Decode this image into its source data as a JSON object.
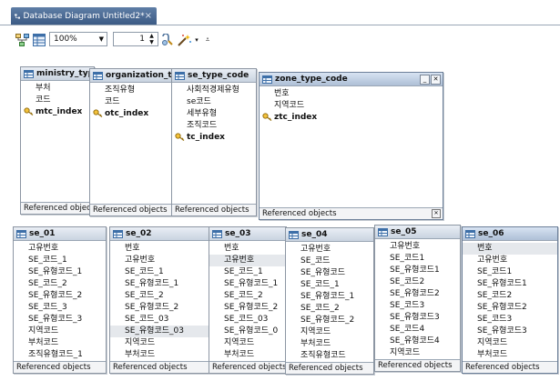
{
  "tab": {
    "title": "Database Diagram Untitled2*",
    "close": "×"
  },
  "toolbar": {
    "zoom": "100%",
    "page": "1",
    "icons": [
      "layout-icon",
      "table-icon",
      "dropdown-arrow-icon",
      "link-icon",
      "magic-icon",
      "overflow-icon"
    ]
  },
  "footer_label": "Referenced objects",
  "tables": [
    {
      "id": "ministry",
      "name": "ministry_typ",
      "rows": [
        {
          "text": "부처"
        },
        {
          "text": "코드"
        },
        {
          "text": "mtc_index",
          "key": true
        }
      ]
    },
    {
      "id": "organization",
      "name": "organization_ty",
      "rows": [
        {
          "text": "조직유형"
        },
        {
          "text": "코드"
        },
        {
          "text": "otc_index",
          "key": true
        }
      ]
    },
    {
      "id": "se_type_code",
      "name": "se_type_code",
      "rows": [
        {
          "text": "사회적경제유형"
        },
        {
          "text": "se코드"
        },
        {
          "text": "세부유형"
        },
        {
          "text": "조직코드"
        },
        {
          "text": "tc_index",
          "key": true
        }
      ]
    },
    {
      "id": "zone_type_code",
      "name": "zone_type_code",
      "rows": [
        {
          "text": "번호"
        },
        {
          "text": "지역코드"
        },
        {
          "text": "ztc_index",
          "key": true
        }
      ]
    },
    {
      "id": "se_01",
      "name": "se_01",
      "rows": [
        {
          "text": "고유번호"
        },
        {
          "text": "SE_코드_1"
        },
        {
          "text": "SE_유형코드_1"
        },
        {
          "text": "SE_코드_2"
        },
        {
          "text": "SE_유형코드_2"
        },
        {
          "text": "SE_코드_3"
        },
        {
          "text": "SE_유형코드_3"
        },
        {
          "text": "지역코드"
        },
        {
          "text": "부처코드"
        },
        {
          "text": "조직유형코드_1"
        }
      ]
    },
    {
      "id": "se_02",
      "name": "se_02",
      "rows": [
        {
          "text": "번호"
        },
        {
          "text": "고유번호"
        },
        {
          "text": "SE_코드_1"
        },
        {
          "text": "SE_유형코드_1"
        },
        {
          "text": "SE_코드_2"
        },
        {
          "text": "SE_유형코드_2"
        },
        {
          "text": "SE_코드_03"
        },
        {
          "text": "SE_유형코드_03",
          "hl": true
        },
        {
          "text": "지역코드"
        },
        {
          "text": "부처코드"
        }
      ]
    },
    {
      "id": "se_03",
      "name": "se_03",
      "rows": [
        {
          "text": "번호"
        },
        {
          "text": "고유번호",
          "hl": true
        },
        {
          "text": "SE_코드_1"
        },
        {
          "text": "SE_유형코드_1"
        },
        {
          "text": "SE_코드_2"
        },
        {
          "text": "SE_유형코드_2"
        },
        {
          "text": "SE_코드_03"
        },
        {
          "text": "SE_유형코드_0"
        },
        {
          "text": "지역코드"
        },
        {
          "text": "부처코드"
        }
      ]
    },
    {
      "id": "se_04",
      "name": "se_04",
      "rows": [
        {
          "text": "고유번호"
        },
        {
          "text": "SE_코드"
        },
        {
          "text": "SE_유형코드"
        },
        {
          "text": "SE_코드_1"
        },
        {
          "text": "SE_유형코드_1"
        },
        {
          "text": "SE_코드_2"
        },
        {
          "text": "SE_유형코드_2"
        },
        {
          "text": "지역코드"
        },
        {
          "text": "부처코드"
        },
        {
          "text": "조직유형코드"
        }
      ]
    },
    {
      "id": "se_05",
      "name": "se_05",
      "rows": [
        {
          "text": "고유번호"
        },
        {
          "text": "SE_코드1"
        },
        {
          "text": "SE_유형코드1"
        },
        {
          "text": "SE_코드2"
        },
        {
          "text": "SE_유형코드2"
        },
        {
          "text": "SE_코드3"
        },
        {
          "text": "SE_유형코드3"
        },
        {
          "text": "SE_코드4"
        },
        {
          "text": "SE_유형코드4"
        },
        {
          "text": "지역코드"
        }
      ]
    },
    {
      "id": "se_06",
      "name": "se_06",
      "rows": [
        {
          "text": "번호",
          "hl": true
        },
        {
          "text": "고유번호"
        },
        {
          "text": "SE_코드1"
        },
        {
          "text": "SE_유형코드1"
        },
        {
          "text": "SE_코드2"
        },
        {
          "text": "SE_유형코드2"
        },
        {
          "text": "SE_코드3"
        },
        {
          "text": "SE_유형코드3"
        },
        {
          "text": "지역코드"
        },
        {
          "text": "부처코드"
        }
      ]
    }
  ]
}
